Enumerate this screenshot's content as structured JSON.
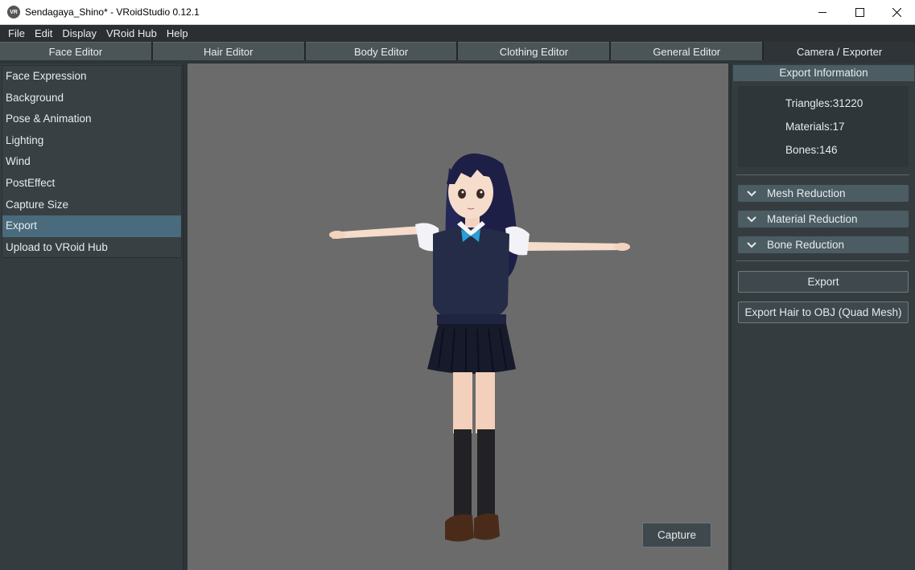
{
  "window": {
    "title": "Sendagaya_Shino* - VRoidStudio 0.12.1",
    "icon_name": "vroid-app-icon"
  },
  "menu": [
    "File",
    "Edit",
    "Display",
    "VRoid Hub",
    "Help"
  ],
  "tabs": [
    {
      "label": "Face Editor",
      "active": false
    },
    {
      "label": "Hair Editor",
      "active": false
    },
    {
      "label": "Body Editor",
      "active": false
    },
    {
      "label": "Clothing Editor",
      "active": false
    },
    {
      "label": "General Editor",
      "active": false
    },
    {
      "label": "Camera / Exporter",
      "active": true
    }
  ],
  "sidebar": {
    "items": [
      {
        "label": "Face Expression"
      },
      {
        "label": "Background"
      },
      {
        "label": "Pose & Animation"
      },
      {
        "label": "Lighting"
      },
      {
        "label": "Wind"
      },
      {
        "label": "PostEffect"
      },
      {
        "label": "Capture Size"
      },
      {
        "label": "Export",
        "selected": true
      },
      {
        "label": "Upload to VRoid Hub"
      }
    ]
  },
  "viewport": {
    "capture_label": "Capture",
    "background_color": "#6b6b6b"
  },
  "export_panel": {
    "header": "Export Information",
    "triangles": "Triangles:31220",
    "materials": "Materials:17",
    "bones": "Bones:146",
    "sections": [
      "Mesh Reduction",
      "Material Reduction",
      "Bone Reduction"
    ],
    "export_label": "Export",
    "export_hair_label": "Export Hair to OBJ (Quad Mesh)"
  },
  "colors": {
    "accent_selected": "#4a6b7d",
    "panel_header": "#4b5c63"
  }
}
